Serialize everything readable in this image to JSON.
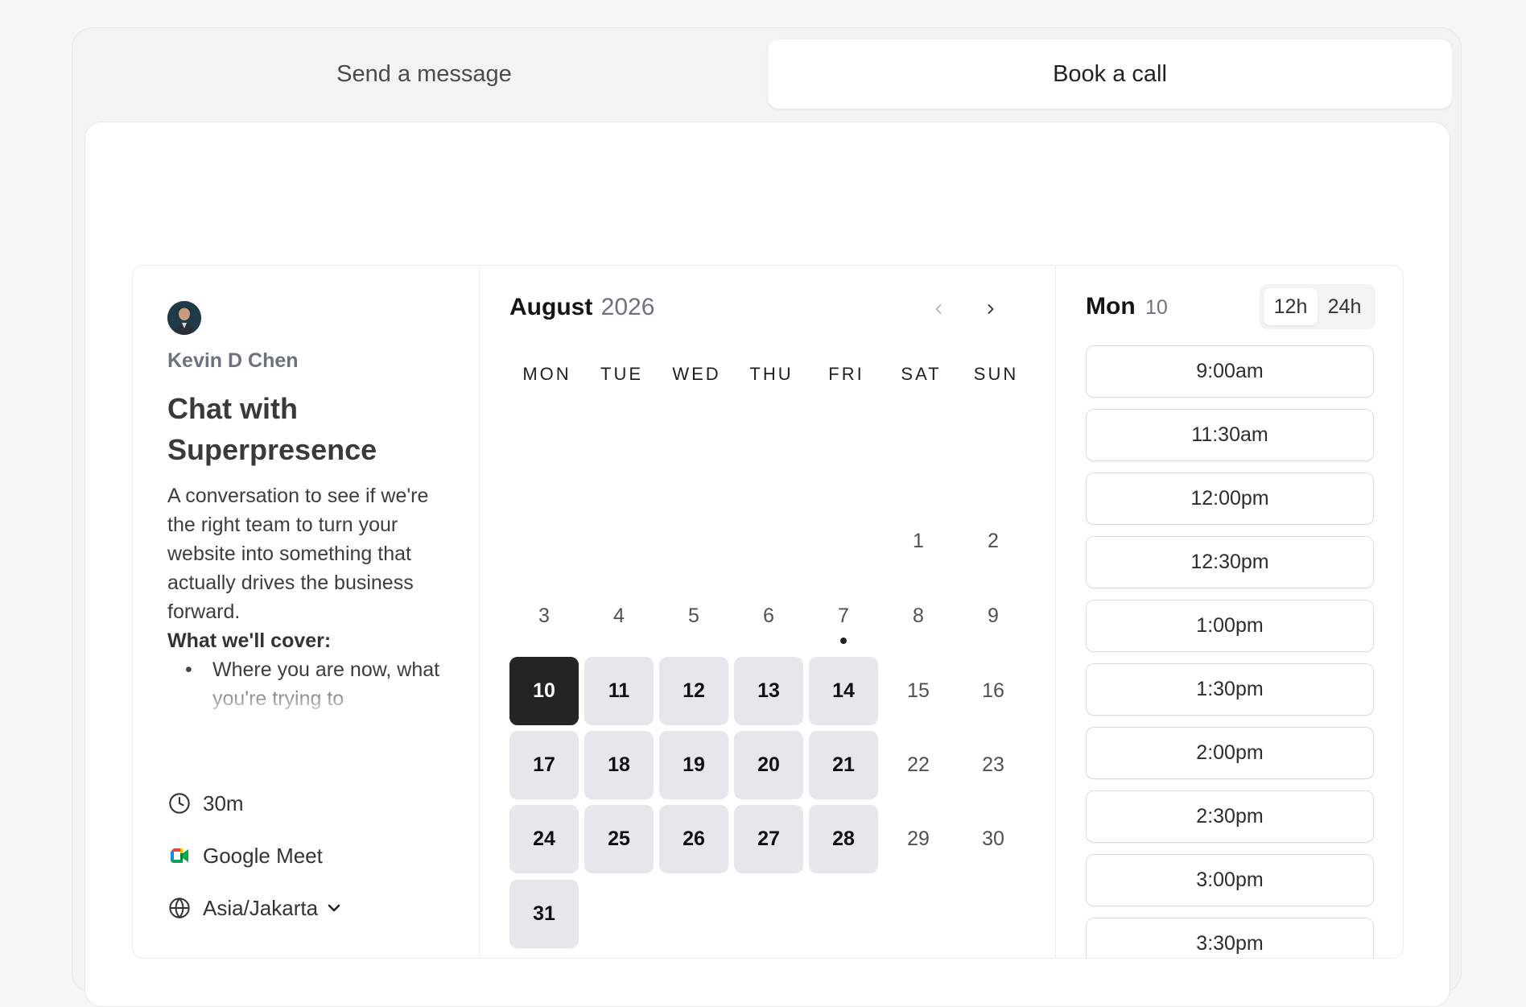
{
  "tabs": {
    "message_label": "Send a message",
    "call_label": "Book a call",
    "active": "call"
  },
  "event": {
    "organizer": "Kevin D Chen",
    "title": "Chat with Superpresence",
    "description": "A conversation to see if we're the right team to turn your website into something that actually drives the business forward.",
    "cover_heading": "What we'll cover:",
    "cover_items": [
      "Where you are now, what you're trying to"
    ],
    "duration": "30m",
    "location": "Google Meet",
    "timezone": "Asia/Jakarta"
  },
  "calendar": {
    "month": "August",
    "year": "2026",
    "weekdays": [
      "MON",
      "TUE",
      "WED",
      "THU",
      "FRI",
      "SAT",
      "SUN"
    ],
    "first_weekday_index": 5,
    "days_in_month": 31,
    "today": 7,
    "selected": 10,
    "available_days": [
      10,
      11,
      12,
      13,
      14,
      17,
      18,
      19,
      20,
      21,
      24,
      25,
      26,
      27,
      28,
      31
    ]
  },
  "slots": {
    "day_name": "Mon",
    "day_number": "10",
    "format_12h": "12h",
    "format_24h": "24h",
    "active_format": "12h",
    "times": [
      "9:00am",
      "11:30am",
      "12:00pm",
      "12:30pm",
      "1:00pm",
      "1:30pm",
      "2:00pm",
      "2:30pm",
      "3:00pm",
      "3:30pm"
    ]
  },
  "colors": {
    "selected_day": "#242424",
    "available_day": "#e5e7eb",
    "muted_text": "#6b7280"
  }
}
